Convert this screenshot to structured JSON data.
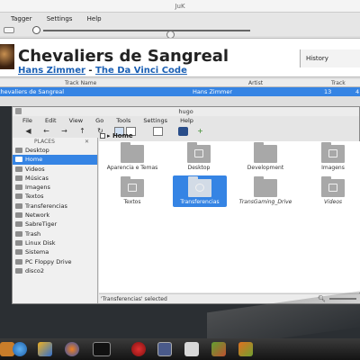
{
  "juk": {
    "title": "JuK",
    "menu": [
      "Tagger",
      "Settings",
      "Help"
    ],
    "now_playing": {
      "title": "Chevaliers de Sangreal",
      "artist": "Hans Zimmer",
      "separator": "-",
      "album": "The Da Vinci Code"
    },
    "history_tab": "History",
    "columns": [
      "Track Name",
      "Artist",
      "Track"
    ],
    "selected_row": {
      "track": "Chevaliers de Sangreal",
      "artist": "Hans Zimmer",
      "number": "13",
      "extra": "4"
    }
  },
  "filemanager": {
    "title": "hugo",
    "menu": [
      "File",
      "Edit",
      "View",
      "Go",
      "Tools",
      "Settings",
      "Help"
    ],
    "places_header": "PLACES",
    "places": [
      {
        "label": "Desktop",
        "selected": false
      },
      {
        "label": "Home",
        "selected": true
      },
      {
        "label": "Videos",
        "selected": false
      },
      {
        "label": "Músicas",
        "selected": false
      },
      {
        "label": "Imagens",
        "selected": false
      },
      {
        "label": "Textos",
        "selected": false
      },
      {
        "label": "Transferencias",
        "selected": false
      },
      {
        "label": "Network",
        "selected": false
      },
      {
        "label": "SabreTiger",
        "selected": false
      },
      {
        "label": "Trash",
        "selected": false
      },
      {
        "label": "Linux Disk",
        "selected": false
      },
      {
        "label": "Sistema",
        "selected": false
      },
      {
        "label": "PC Floppy Drive",
        "selected": false
      },
      {
        "label": "disco2",
        "selected": false
      }
    ],
    "path": "Home",
    "folders": [
      {
        "label": "Aparencia e Temas",
        "selected": false
      },
      {
        "label": "Desktop",
        "selected": false
      },
      {
        "label": "Development",
        "selected": false
      },
      {
        "label": "Imagens",
        "selected": false
      },
      {
        "label": "Textos",
        "selected": false
      },
      {
        "label": "Transferencias",
        "selected": true
      },
      {
        "label": "TransGaming_Drive",
        "selected": false
      },
      {
        "label": "Videos",
        "selected": false
      }
    ],
    "status": "'Transferencias' selected"
  },
  "colors": {
    "selection": "#3584e4",
    "link": "#1a5fb4",
    "taskbar": "#1b1b1b"
  },
  "taskbar_icons": [
    "wrench-icon",
    "globe-icon",
    "rocket-icon",
    "firefox-icon",
    "terminal-icon",
    "opera-icon",
    "tasks-icon",
    "screenshot-icon",
    "tools-icon",
    "game-icon"
  ]
}
